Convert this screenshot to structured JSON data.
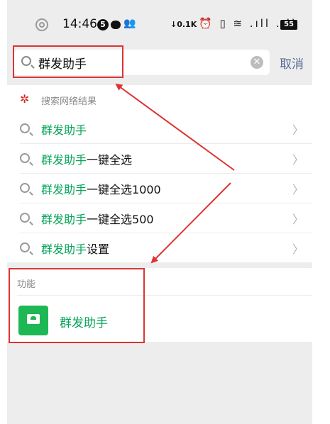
{
  "status_bar": {
    "time": "14:46",
    "notification_count": "5",
    "net_speed": "↓0.1K",
    "icons_text": "⏰ ▯ ≋ .ıll .ıll",
    "battery": "55"
  },
  "search": {
    "query": "群发助手",
    "cancel_label": "取消"
  },
  "results": {
    "header": "搜索网络结果",
    "items": [
      {
        "highlight": "群发助手",
        "suffix": ""
      },
      {
        "highlight": "群发助手",
        "suffix": "一键全选"
      },
      {
        "highlight": "群发助手",
        "suffix": "一键全选1000"
      },
      {
        "highlight": "群发助手",
        "suffix": "一键全选500"
      },
      {
        "highlight": "群发助手",
        "suffix": "设置"
      }
    ]
  },
  "functions": {
    "title": "功能",
    "item_label": "群发助手"
  },
  "colors": {
    "highlight_green": "#07a35a",
    "link_blue": "#576b95",
    "annotation_red": "#d33333",
    "background": "#ededed"
  }
}
